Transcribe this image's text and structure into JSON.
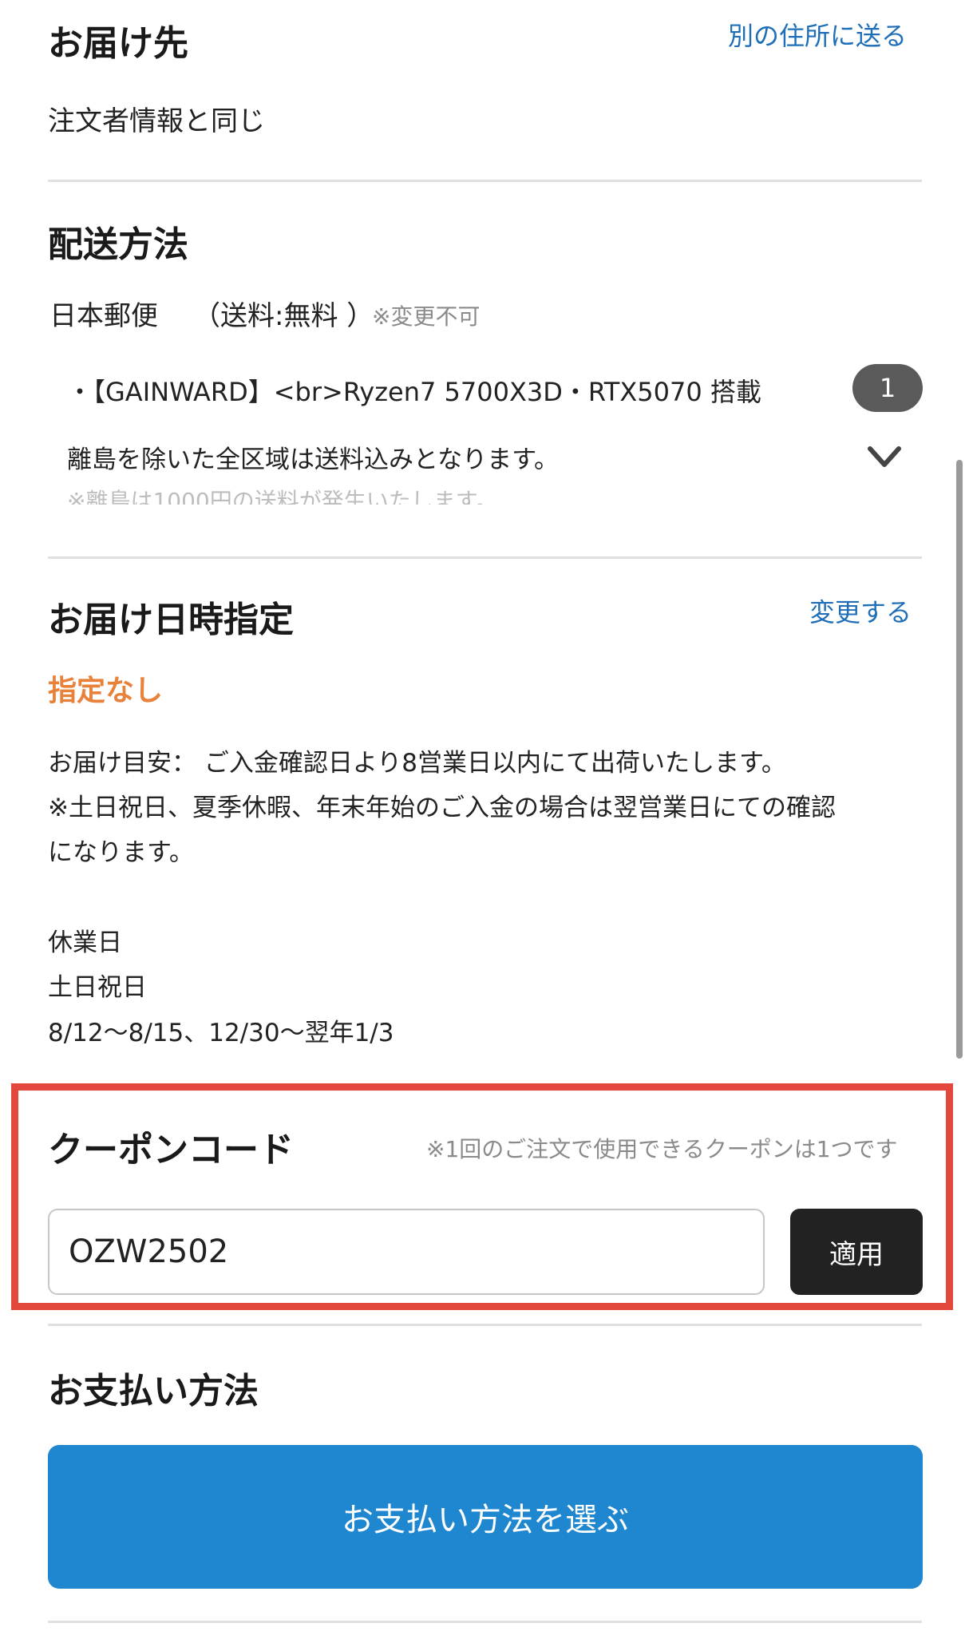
{
  "delivery_address": {
    "title": "お届け先",
    "alt_link": "別の住所に送る",
    "value": "注文者情報と同じ"
  },
  "shipping": {
    "title": "配送方法",
    "carrier": "日本郵便",
    "fee": "（送料:無料 ）",
    "note": "※変更不可",
    "item": "・【GAINWARD】<br>Ryzen7 5700X3D・RTX5070 搭載",
    "item_qty": "1",
    "desc_line1": "離島を除いた全区域は送料込みとなります。",
    "desc_line2": "※離島は1000円の送料が発生いたします。"
  },
  "delivery_time": {
    "title": "お届け日時指定",
    "change_link": "変更する",
    "selected": "指定なし",
    "estimate_line1": "お届け目安： ご入金確認日より8営業日以内にて出荷いたします。",
    "estimate_line2": "※土日祝日、夏季休暇、年末年始のご入金の場合は翌営業日にての確認",
    "estimate_line3": "になります。",
    "holiday_label": "休業日",
    "holiday_weekends": "土日祝日",
    "holiday_dates": "8/12〜8/15、12/30〜翌年1/3"
  },
  "coupon": {
    "title": "クーポンコード",
    "note": "※1回のご注文で使用できるクーポンは1つです",
    "value": "OZW2502",
    "apply_label": "適用"
  },
  "payment": {
    "title": "お支払い方法",
    "select_label": "お支払い方法を選ぶ"
  },
  "colors": {
    "link": "#1f6fb8",
    "accent_orange": "#e8823a",
    "highlight_red": "#e4473b",
    "primary_button": "#1f87cf",
    "dark_button": "#222222"
  }
}
